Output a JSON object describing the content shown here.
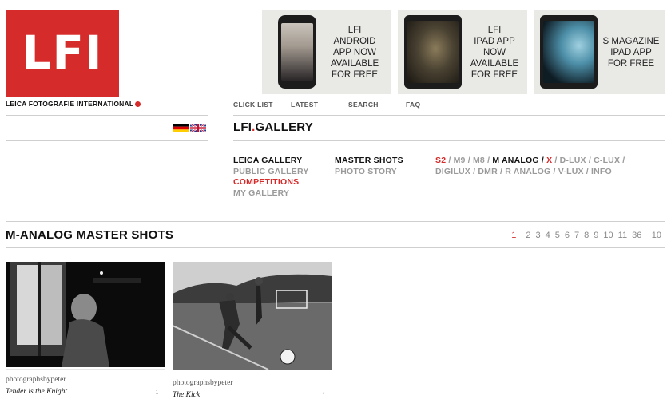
{
  "logo": {
    "mark": "LFI",
    "subtitle": "LEICA FOTOGRAFIE INTERNATIONAL"
  },
  "promos": [
    {
      "lines": [
        "LFI",
        "ANDROID",
        "APP NOW",
        "AVAILABLE",
        "FOR FREE"
      ]
    },
    {
      "lines": [
        "LFI",
        "IPAD APP",
        "NOW",
        "AVAILABLE",
        "FOR FREE"
      ]
    },
    {
      "lines": [
        "S MAGAZINE",
        "IPAD APP",
        "FOR FREE"
      ]
    }
  ],
  "nav": {
    "items": [
      "CLICK LIST",
      "LATEST",
      "SEARCH",
      "FAQ"
    ]
  },
  "gallery_title": {
    "prefix": "LFI",
    "dot": ".",
    "name": "GALLERY"
  },
  "menu": {
    "col1": [
      "LEICA GALLERY",
      "PUBLIC GALLERY",
      "COMPETITIONS",
      "MY GALLERY"
    ],
    "col2": [
      "MASTER SHOTS",
      "PHOTO STORY"
    ],
    "col3": {
      "line1": [
        {
          "text": "S2",
          "color": "red"
        },
        {
          "text": " / ",
          "color": "grey"
        },
        {
          "text": "M9",
          "color": "grey"
        },
        {
          "text": " / ",
          "color": "grey"
        },
        {
          "text": "M8",
          "color": "grey"
        },
        {
          "text": " / ",
          "color": "grey"
        },
        {
          "text": "M ANALOG",
          "color": "dark"
        },
        {
          "text": " / ",
          "color": "dark"
        },
        {
          "text": "X",
          "color": "red"
        },
        {
          "text": " / ",
          "color": "grey"
        },
        {
          "text": "D-LUX",
          "color": "grey"
        },
        {
          "text": " / ",
          "color": "grey"
        },
        {
          "text": "C-LUX",
          "color": "grey"
        },
        {
          "text": " /",
          "color": "grey"
        }
      ],
      "line2": "DIGILUX / DMR / R ANALOG / V-LUX / INFO"
    }
  },
  "section_title": "M-ANALOG MASTER SHOTS",
  "pagination": {
    "current": "1",
    "pages": [
      "2",
      "3",
      "4",
      "5",
      "6",
      "7",
      "8",
      "9",
      "10",
      "11",
      "36",
      "+10"
    ]
  },
  "photos": [
    {
      "author": "photographsbypeter",
      "title": "Tender is the Knight",
      "info": "i"
    },
    {
      "author": "photographsbypeter",
      "title": "The Kick",
      "info": "i"
    }
  ]
}
